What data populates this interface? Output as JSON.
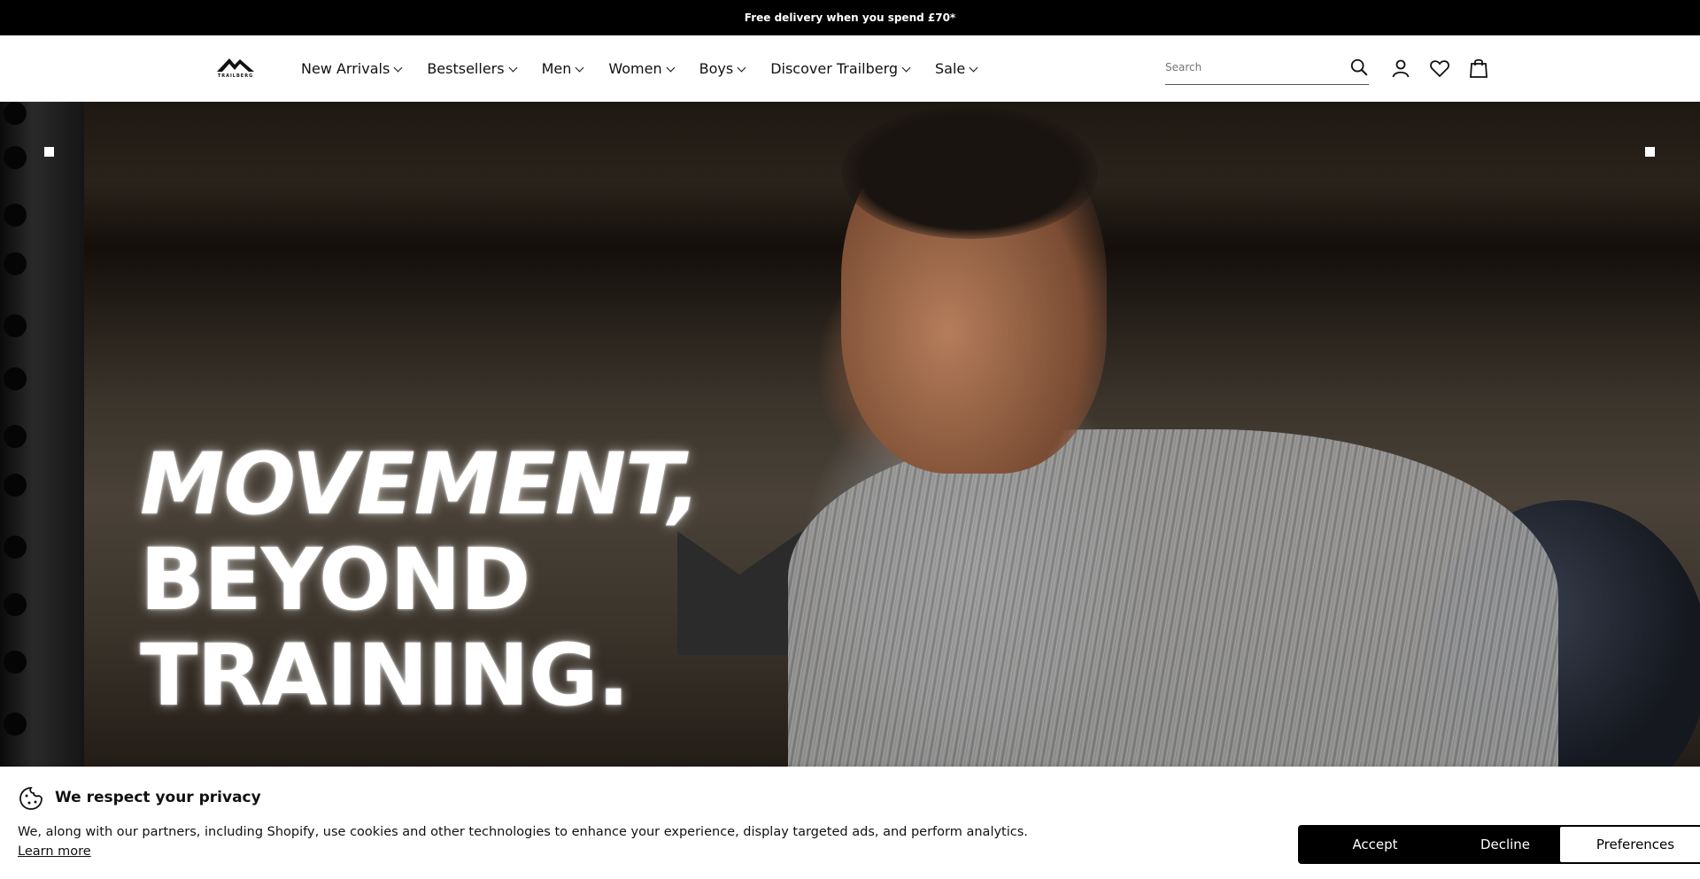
{
  "announcement": "Free delivery when you spend £70*",
  "brand": {
    "name": "TRAILBERG"
  },
  "nav": {
    "items": [
      {
        "label": "New Arrivals"
      },
      {
        "label": "Bestsellers"
      },
      {
        "label": "Men"
      },
      {
        "label": "Women"
      },
      {
        "label": "Boys"
      },
      {
        "label": "Discover Trailberg"
      },
      {
        "label": "Sale"
      }
    ]
  },
  "search": {
    "placeholder": "Search"
  },
  "hero": {
    "headline": [
      "MOVEMENT,",
      "BEYOND",
      "TRAINING."
    ]
  },
  "cookie_banner": {
    "title": "We respect your privacy",
    "text": "We, along with our partners, including Shopify, use cookies and other technologies to enhance your experience, display targeted ads, and perform analytics.",
    "learn_more": "Learn more",
    "accept": "Accept",
    "decline": "Decline",
    "preferences": "Preferences"
  },
  "icons": [
    "search-icon",
    "account-icon",
    "wishlist-heart-icon",
    "cart-bag-icon",
    "cookie-icon",
    "chevron-down-icon"
  ]
}
